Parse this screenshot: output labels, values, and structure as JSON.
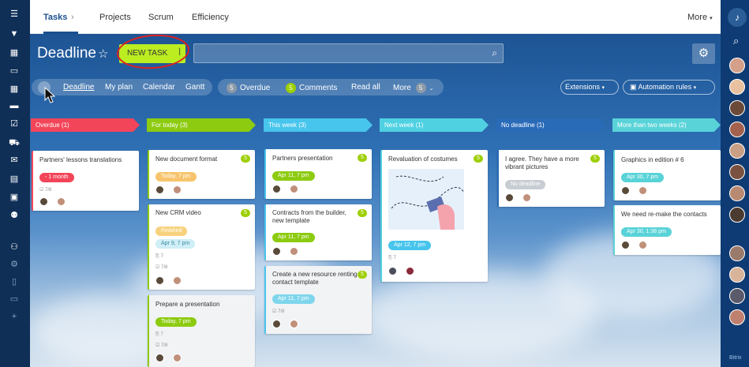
{
  "nav": {
    "items": [
      "Tasks",
      "Projects",
      "Scrum",
      "Efficiency",
      "More"
    ]
  },
  "header": {
    "title": "Deadline",
    "new_task": "NEW TASK"
  },
  "filters": {
    "views": [
      "Deadline",
      "My plan",
      "Calendar",
      "Gantt"
    ],
    "overdue_count": "5",
    "overdue": "Overdue",
    "comments_count": "5",
    "comments": "Comments",
    "read_all": "Read all",
    "more": "More",
    "more_count": "5",
    "extensions": "Extensions",
    "automation": "Automation rules"
  },
  "columns": [
    {
      "name": "Overdue",
      "count": "(1)",
      "color": "#f3455a"
    },
    {
      "name": "For today",
      "count": "(3)",
      "color": "#8dcb10"
    },
    {
      "name": "This week",
      "count": "(3)",
      "color": "#47c5ec"
    },
    {
      "name": "Next week",
      "count": "(1)",
      "color": "#4fd1e2"
    },
    {
      "name": "No deadline",
      "count": "(1)",
      "color": "#2a6bb8"
    },
    {
      "name": "More than two weeks",
      "count": "(2)",
      "color": "#59d3d8"
    }
  ],
  "cards": {
    "c1": {
      "title": "Partners' lessons translations",
      "tag": "- 1 month",
      "meta": "7/8"
    },
    "c2": {
      "title": "New document format",
      "tag": "Today, 7 pm",
      "badge": "5"
    },
    "c3": {
      "title": "New CRM video",
      "tag": "Finished",
      "tag2": "Apr 9, 7 pm",
      "meta": "7",
      "meta2": "7/8",
      "badge": "5"
    },
    "c4": {
      "title": "Prepare a presentation",
      "tag": "Today, 7 pm",
      "meta": "7",
      "meta2": "7/8"
    },
    "c5": {
      "title": "Partners presentation",
      "tag": "Apr 11, 7 pm",
      "badge": "5"
    },
    "c6": {
      "title": "Contracts from the builder, new template",
      "tag": "Apr 11, 7 pm",
      "badge": "5"
    },
    "c7": {
      "title": "Create a new resource renting contact template",
      "tag": "Apr 11, 7 pm",
      "meta": "7/8",
      "badge": "5"
    },
    "c8": {
      "title": "Revaluation of costumes",
      "tag": "Apr 12, 7 pm",
      "meta": "7",
      "badge": "5"
    },
    "c9": {
      "title": "I agree. They have a more vibrant pictures",
      "tag": "No deadline",
      "badge": "5"
    },
    "c10": {
      "title": "Graphics in edition # 6",
      "tag": "Apr 30, 7 pm"
    },
    "c11": {
      "title": "We need re-make the contacts",
      "tag": "Apr 30, 1:38 pm"
    }
  },
  "footer": {
    "brand": "Bitrix"
  }
}
